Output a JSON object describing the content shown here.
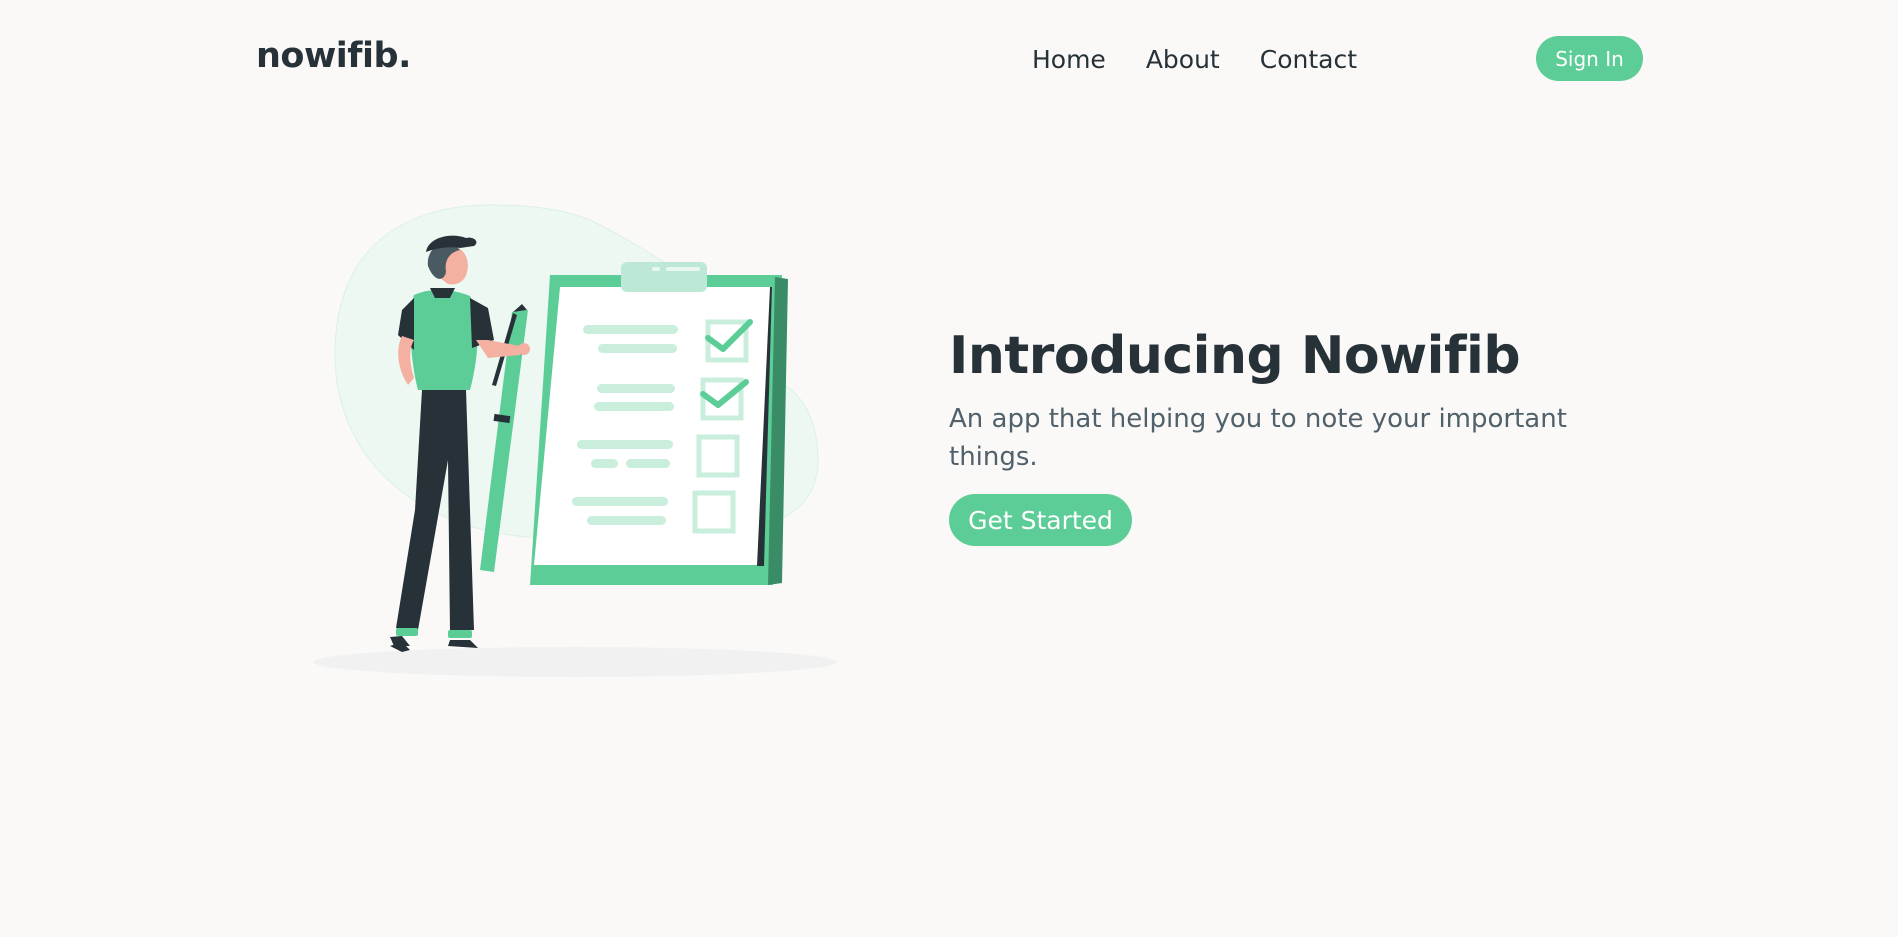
{
  "brand": {
    "logo": "nowifib."
  },
  "nav": {
    "links": [
      "Home",
      "About",
      "Contact"
    ],
    "signin_label": "Sign In"
  },
  "hero": {
    "title": "Introducing Nowifib",
    "subtitle": "An app that helping you to note your important things.",
    "cta_label": "Get Started"
  },
  "colors": {
    "accent": "#5ccd96",
    "text_dark": "#263238",
    "text_muted": "#51616b",
    "background": "#faf9f8"
  },
  "illustration": {
    "icon": "checklist-illustration"
  }
}
